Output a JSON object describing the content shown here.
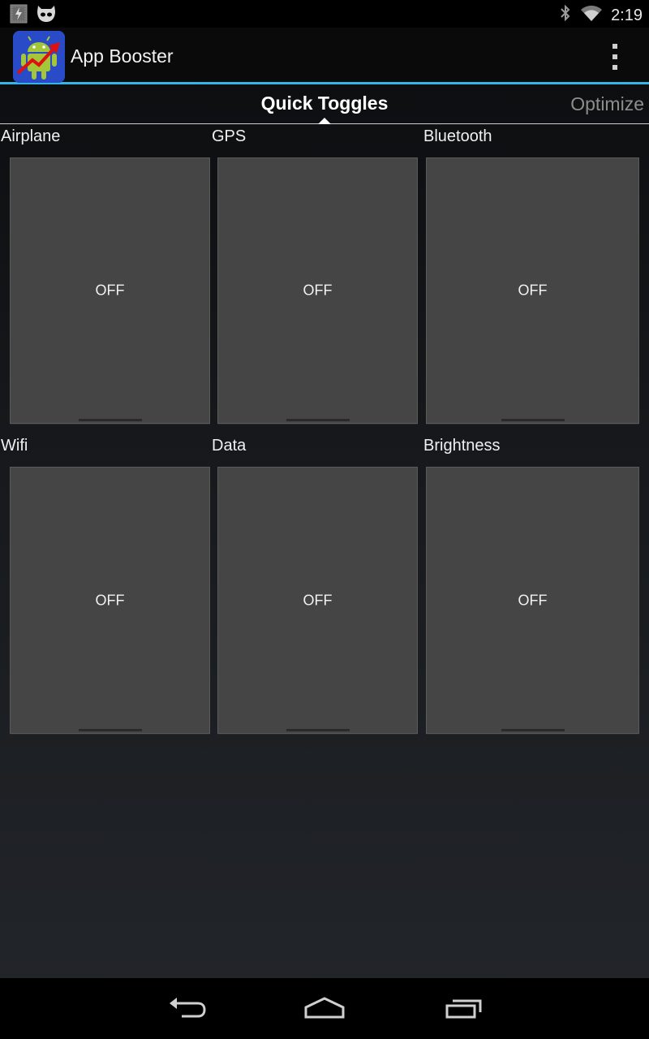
{
  "status_bar": {
    "time": "2:19",
    "icons": [
      "battery-charging-icon",
      "cyanogen-icon",
      "bluetooth-icon",
      "wifi-icon"
    ]
  },
  "action_bar": {
    "title": "App Booster",
    "app_icon": "android-booster-icon",
    "accent_color": "#33b5e5"
  },
  "tabs": {
    "active": "Quick Toggles",
    "inactive": "Optimize"
  },
  "toggles": [
    {
      "label": "Airplane",
      "state": "OFF"
    },
    {
      "label": "GPS",
      "state": "OFF"
    },
    {
      "label": "Bluetooth",
      "state": "OFF"
    },
    {
      "label": "Wifi",
      "state": "OFF"
    },
    {
      "label": "Data",
      "state": "OFF"
    },
    {
      "label": "Brightness",
      "state": "OFF"
    }
  ],
  "nav_bar": {
    "icons": [
      "back-icon",
      "home-icon",
      "recents-icon"
    ]
  }
}
